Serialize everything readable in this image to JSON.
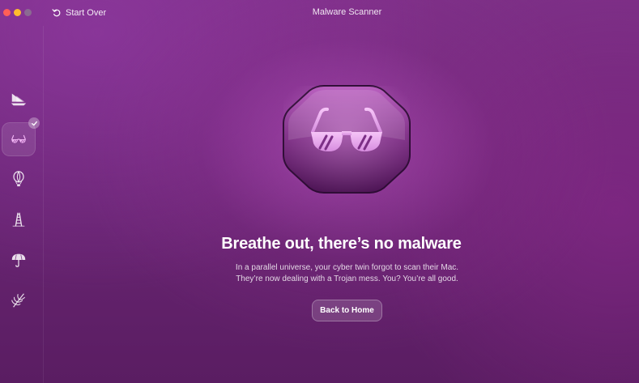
{
  "window": {
    "title": "Malware Scanner",
    "start_over_label": "Start Over"
  },
  "sidebar": {
    "items": [
      {
        "icon": "sailboat-icon",
        "active": false
      },
      {
        "icon": "sunglasses-icon",
        "active": true,
        "completed": true
      },
      {
        "icon": "hot-air-balloon-icon",
        "active": false
      },
      {
        "icon": "ladder-icon",
        "active": false
      },
      {
        "icon": "umbrella-icon",
        "active": false
      },
      {
        "icon": "palm-leaf-icon",
        "active": false
      }
    ]
  },
  "main": {
    "hero_icon": "sunglasses-icon",
    "headline": "Breathe out, there’s no malware",
    "description_line1": "In a parallel universe, your cyber twin forgot to scan their Mac.",
    "description_line2": "They’re now dealing with a Trojan mess. You? You’re all good.",
    "back_button_label": "Back to Home"
  },
  "colors": {
    "background": "#6b2675",
    "close": "#ff5f57",
    "minimize": "#febc2e",
    "accent": "#d48ce0"
  }
}
